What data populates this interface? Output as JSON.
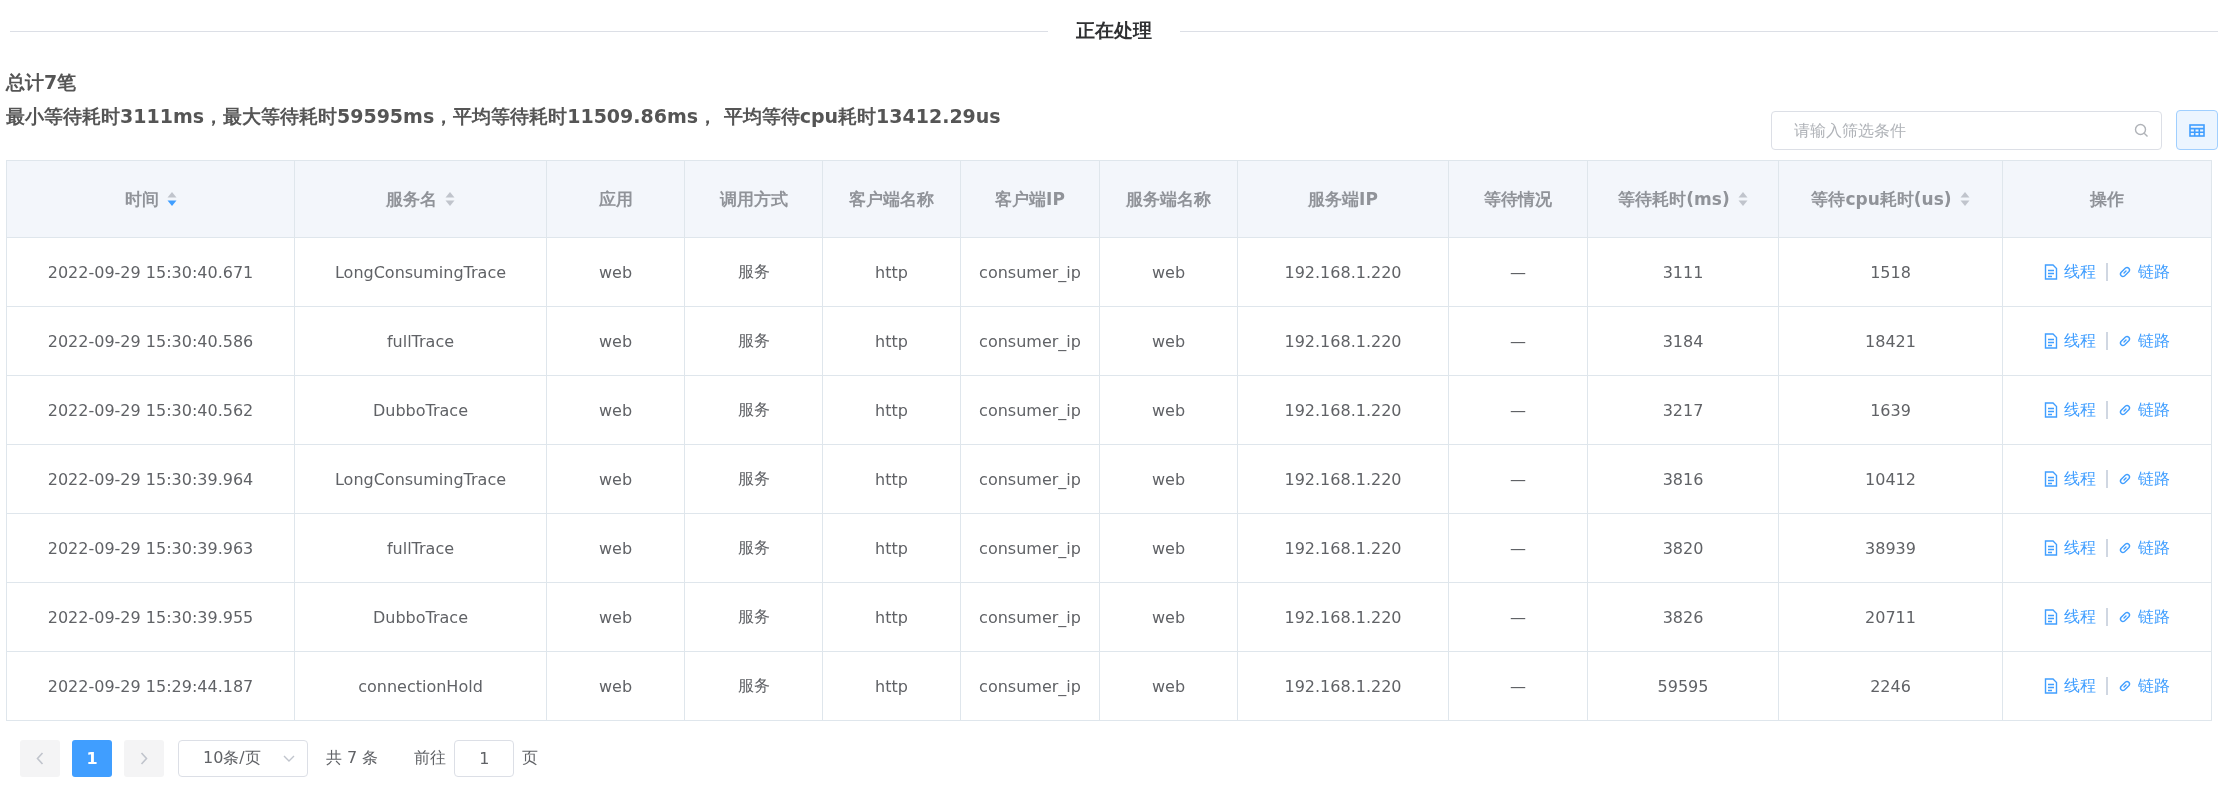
{
  "section_title": "正在处理",
  "summary": {
    "total": "总计7笔",
    "stats": "最小等待耗时3111ms，最大等待耗时59595ms，平均等待耗时11509.86ms， 平均等待cpu耗时13412.29us"
  },
  "search": {
    "placeholder": "请输入筛选条件"
  },
  "table": {
    "columns": [
      {
        "label": "时间",
        "sorted_descending": true
      },
      {
        "label": "服务名",
        "sorted_descending": false
      },
      {
        "label": "应用"
      },
      {
        "label": "调用方式"
      },
      {
        "label": "客户端名称"
      },
      {
        "label": "客户端IP"
      },
      {
        "label": "服务端名称"
      },
      {
        "label": "服务端IP"
      },
      {
        "label": "等待情况"
      },
      {
        "label": "等待耗时(ms)",
        "sorted_descending": false
      },
      {
        "label": "等待cpu耗时(us)",
        "sorted_descending": false
      },
      {
        "label": "操作"
      }
    ],
    "rows": [
      {
        "cells": [
          "2022-09-29 15:30:40.671",
          "LongConsumingTrace",
          "web",
          "服务",
          "http",
          "consumer_ip",
          "web",
          "192.168.1.220",
          "—",
          "3111",
          "1518"
        ],
        "actions": [
          "线程",
          "链路"
        ]
      },
      {
        "cells": [
          "2022-09-29 15:30:40.586",
          "fullTrace",
          "web",
          "服务",
          "http",
          "consumer_ip",
          "web",
          "192.168.1.220",
          "—",
          "3184",
          "18421"
        ],
        "actions": [
          "线程",
          "链路"
        ]
      },
      {
        "cells": [
          "2022-09-29 15:30:40.562",
          "DubboTrace",
          "web",
          "服务",
          "http",
          "consumer_ip",
          "web",
          "192.168.1.220",
          "—",
          "3217",
          "1639"
        ],
        "actions": [
          "线程",
          "链路"
        ]
      },
      {
        "cells": [
          "2022-09-29 15:30:39.964",
          "LongConsumingTrace",
          "web",
          "服务",
          "http",
          "consumer_ip",
          "web",
          "192.168.1.220",
          "—",
          "3816",
          "10412"
        ],
        "actions": [
          "线程",
          "链路"
        ]
      },
      {
        "cells": [
          "2022-09-29 15:30:39.963",
          "fullTrace",
          "web",
          "服务",
          "http",
          "consumer_ip",
          "web",
          "192.168.1.220",
          "—",
          "3820",
          "38939"
        ],
        "actions": [
          "线程",
          "链路"
        ]
      },
      {
        "cells": [
          "2022-09-29 15:30:39.955",
          "DubboTrace",
          "web",
          "服务",
          "http",
          "consumer_ip",
          "web",
          "192.168.1.220",
          "—",
          "3826",
          "20711"
        ],
        "actions": [
          "线程",
          "链路"
        ]
      },
      {
        "cells": [
          "2022-09-29 15:29:44.187",
          "connectionHold",
          "web",
          "服务",
          "http",
          "consumer_ip",
          "web",
          "192.168.1.220",
          "—",
          "59595",
          "2246"
        ],
        "actions": [
          "线程",
          "链路"
        ]
      }
    ]
  },
  "pagination": {
    "prev_disabled": true,
    "next_disabled": true,
    "pages": [
      {
        "label": "1",
        "selected": true
      }
    ],
    "page_size": "10条/页",
    "total": "共 7 条",
    "goto_label": "前往",
    "goto_value": "1",
    "goto_suffix": "页"
  }
}
